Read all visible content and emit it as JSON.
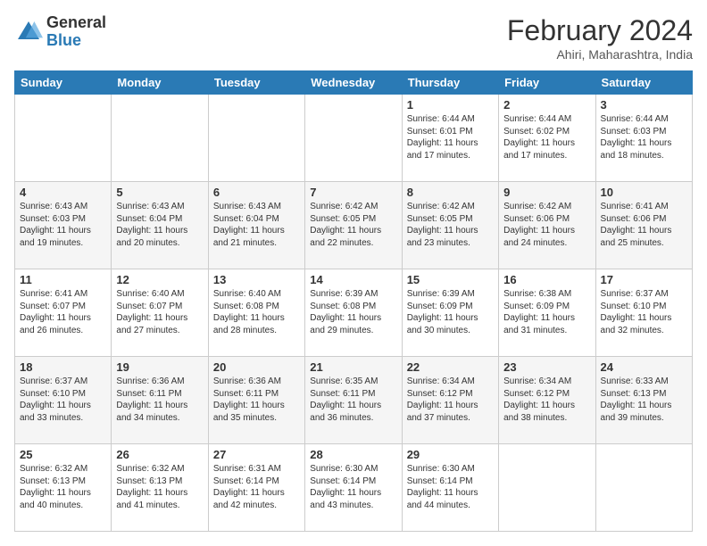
{
  "header": {
    "logo_general": "General",
    "logo_blue": "Blue",
    "month_title": "February 2024",
    "subtitle": "Ahiri, Maharashtra, India"
  },
  "days_of_week": [
    "Sunday",
    "Monday",
    "Tuesday",
    "Wednesday",
    "Thursday",
    "Friday",
    "Saturday"
  ],
  "weeks": [
    [
      {
        "day": "",
        "info": ""
      },
      {
        "day": "",
        "info": ""
      },
      {
        "day": "",
        "info": ""
      },
      {
        "day": "",
        "info": ""
      },
      {
        "day": "1",
        "info": "Sunrise: 6:44 AM\nSunset: 6:01 PM\nDaylight: 11 hours and 17 minutes."
      },
      {
        "day": "2",
        "info": "Sunrise: 6:44 AM\nSunset: 6:02 PM\nDaylight: 11 hours and 17 minutes."
      },
      {
        "day": "3",
        "info": "Sunrise: 6:44 AM\nSunset: 6:03 PM\nDaylight: 11 hours and 18 minutes."
      }
    ],
    [
      {
        "day": "4",
        "info": "Sunrise: 6:43 AM\nSunset: 6:03 PM\nDaylight: 11 hours and 19 minutes."
      },
      {
        "day": "5",
        "info": "Sunrise: 6:43 AM\nSunset: 6:04 PM\nDaylight: 11 hours and 20 minutes."
      },
      {
        "day": "6",
        "info": "Sunrise: 6:43 AM\nSunset: 6:04 PM\nDaylight: 11 hours and 21 minutes."
      },
      {
        "day": "7",
        "info": "Sunrise: 6:42 AM\nSunset: 6:05 PM\nDaylight: 11 hours and 22 minutes."
      },
      {
        "day": "8",
        "info": "Sunrise: 6:42 AM\nSunset: 6:05 PM\nDaylight: 11 hours and 23 minutes."
      },
      {
        "day": "9",
        "info": "Sunrise: 6:42 AM\nSunset: 6:06 PM\nDaylight: 11 hours and 24 minutes."
      },
      {
        "day": "10",
        "info": "Sunrise: 6:41 AM\nSunset: 6:06 PM\nDaylight: 11 hours and 25 minutes."
      }
    ],
    [
      {
        "day": "11",
        "info": "Sunrise: 6:41 AM\nSunset: 6:07 PM\nDaylight: 11 hours and 26 minutes."
      },
      {
        "day": "12",
        "info": "Sunrise: 6:40 AM\nSunset: 6:07 PM\nDaylight: 11 hours and 27 minutes."
      },
      {
        "day": "13",
        "info": "Sunrise: 6:40 AM\nSunset: 6:08 PM\nDaylight: 11 hours and 28 minutes."
      },
      {
        "day": "14",
        "info": "Sunrise: 6:39 AM\nSunset: 6:08 PM\nDaylight: 11 hours and 29 minutes."
      },
      {
        "day": "15",
        "info": "Sunrise: 6:39 AM\nSunset: 6:09 PM\nDaylight: 11 hours and 30 minutes."
      },
      {
        "day": "16",
        "info": "Sunrise: 6:38 AM\nSunset: 6:09 PM\nDaylight: 11 hours and 31 minutes."
      },
      {
        "day": "17",
        "info": "Sunrise: 6:37 AM\nSunset: 6:10 PM\nDaylight: 11 hours and 32 minutes."
      }
    ],
    [
      {
        "day": "18",
        "info": "Sunrise: 6:37 AM\nSunset: 6:10 PM\nDaylight: 11 hours and 33 minutes."
      },
      {
        "day": "19",
        "info": "Sunrise: 6:36 AM\nSunset: 6:11 PM\nDaylight: 11 hours and 34 minutes."
      },
      {
        "day": "20",
        "info": "Sunrise: 6:36 AM\nSunset: 6:11 PM\nDaylight: 11 hours and 35 minutes."
      },
      {
        "day": "21",
        "info": "Sunrise: 6:35 AM\nSunset: 6:11 PM\nDaylight: 11 hours and 36 minutes."
      },
      {
        "day": "22",
        "info": "Sunrise: 6:34 AM\nSunset: 6:12 PM\nDaylight: 11 hours and 37 minutes."
      },
      {
        "day": "23",
        "info": "Sunrise: 6:34 AM\nSunset: 6:12 PM\nDaylight: 11 hours and 38 minutes."
      },
      {
        "day": "24",
        "info": "Sunrise: 6:33 AM\nSunset: 6:13 PM\nDaylight: 11 hours and 39 minutes."
      }
    ],
    [
      {
        "day": "25",
        "info": "Sunrise: 6:32 AM\nSunset: 6:13 PM\nDaylight: 11 hours and 40 minutes."
      },
      {
        "day": "26",
        "info": "Sunrise: 6:32 AM\nSunset: 6:13 PM\nDaylight: 11 hours and 41 minutes."
      },
      {
        "day": "27",
        "info": "Sunrise: 6:31 AM\nSunset: 6:14 PM\nDaylight: 11 hours and 42 minutes."
      },
      {
        "day": "28",
        "info": "Sunrise: 6:30 AM\nSunset: 6:14 PM\nDaylight: 11 hours and 43 minutes."
      },
      {
        "day": "29",
        "info": "Sunrise: 6:30 AM\nSunset: 6:14 PM\nDaylight: 11 hours and 44 minutes."
      },
      {
        "day": "",
        "info": ""
      },
      {
        "day": "",
        "info": ""
      }
    ]
  ]
}
